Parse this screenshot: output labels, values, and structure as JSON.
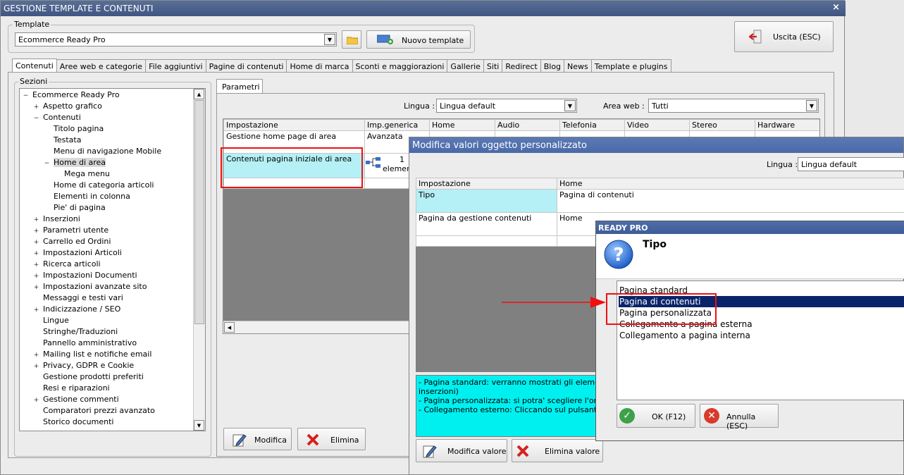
{
  "window": {
    "title": "GESTIONE TEMPLATE E CONTENUTI",
    "close": "×"
  },
  "template": {
    "group_label": "Template",
    "selected": "Ecommerce Ready Pro",
    "new_button": "Nuovo template"
  },
  "exit_button": "Uscita (ESC)",
  "tabs": [
    "Contenuti",
    "Aree web e categorie",
    "File aggiuntivi",
    "Pagine di contenuti",
    "Home di marca",
    "Sconti e maggiorazioni",
    "Gallerie",
    "Siti",
    "Redirect",
    "Blog",
    "News",
    "Template e plugins"
  ],
  "sections": {
    "label": "Sezioni",
    "tree": [
      {
        "label": "Ecommerce Ready Pro",
        "level": 0,
        "exp": "-"
      },
      {
        "label": "Aspetto grafico",
        "level": 1,
        "exp": "+"
      },
      {
        "label": "Contenuti",
        "level": 1,
        "exp": "-"
      },
      {
        "label": "Titolo pagina",
        "level": 2,
        "exp": ""
      },
      {
        "label": "Testata",
        "level": 2,
        "exp": ""
      },
      {
        "label": "Menu di navigazione Mobile",
        "level": 2,
        "exp": ""
      },
      {
        "label": "Home di area",
        "level": 2,
        "exp": "-",
        "selected": true
      },
      {
        "label": "Mega menu",
        "level": 3,
        "exp": ""
      },
      {
        "label": "Home di categoria articoli",
        "level": 2,
        "exp": ""
      },
      {
        "label": "Elementi in colonna",
        "level": 2,
        "exp": ""
      },
      {
        "label": "Pie' di pagina",
        "level": 2,
        "exp": ""
      },
      {
        "label": "Inserzioni",
        "level": 1,
        "exp": "+"
      },
      {
        "label": "Parametri utente",
        "level": 1,
        "exp": "+"
      },
      {
        "label": "Carrello ed Ordini",
        "level": 1,
        "exp": "+"
      },
      {
        "label": "Impostazioni Articoli",
        "level": 1,
        "exp": "+"
      },
      {
        "label": "Ricerca articoli",
        "level": 1,
        "exp": "+"
      },
      {
        "label": "Impostazioni Documenti",
        "level": 1,
        "exp": "+"
      },
      {
        "label": "Impostazioni avanzate sito",
        "level": 1,
        "exp": "+"
      },
      {
        "label": "Messaggi e testi vari",
        "level": 1,
        "exp": ""
      },
      {
        "label": "Indicizzazione / SEO",
        "level": 1,
        "exp": "+"
      },
      {
        "label": "Lingue",
        "level": 1,
        "exp": ""
      },
      {
        "label": "Stringhe/Traduzioni",
        "level": 1,
        "exp": ""
      },
      {
        "label": "Pannello amministrativo",
        "level": 1,
        "exp": ""
      },
      {
        "label": "Mailing list e notifiche email",
        "level": 1,
        "exp": "+"
      },
      {
        "label": "Privacy, GDPR e Cookie",
        "level": 1,
        "exp": "+"
      },
      {
        "label": "Gestione prodotti preferiti",
        "level": 1,
        "exp": ""
      },
      {
        "label": "Resi e riparazioni",
        "level": 1,
        "exp": ""
      },
      {
        "label": "Gestione commenti",
        "level": 1,
        "exp": "+"
      },
      {
        "label": "Comparatori prezzi avanzato",
        "level": 1,
        "exp": ""
      },
      {
        "label": "Storico documenti",
        "level": 1,
        "exp": ""
      }
    ]
  },
  "params": {
    "tab": "Parametri",
    "lingua_label": "Lingua :",
    "lingua_value": "Lingua default",
    "area_label": "Area web :",
    "area_value": "Tutti",
    "columns": [
      "Impostazione",
      "Imp.generica",
      "Home",
      "Audio",
      "Telefonia",
      "Video",
      "Stereo",
      "Hardware"
    ],
    "rows": [
      {
        "name": "Gestione home page di area",
        "generic": "Avanzata"
      },
      {
        "name": "Contenuti pagina iniziale di area",
        "generic_count": "1",
        "generic_unit": "element"
      }
    ],
    "modify_button": "Modifica",
    "delete_button": "Elimina"
  },
  "dialog": {
    "title": "Modifica valori oggetto personalizzato",
    "lingua_label": "Lingua :",
    "lingua_value": "Lingua default",
    "columns": [
      "Impostazione",
      "Home"
    ],
    "rows": [
      {
        "name": "Tipo",
        "value": "Pagina di contenuti"
      },
      {
        "name": "Pagina da gestione contenuti",
        "value": "Home"
      }
    ],
    "help_lines": [
      "- Pagina standard: verranno mostrati gli elementi in p",
      "inserzioni)",
      "- Pagina personalizzata: si potra' scegliere l'ordine de",
      "- Collegamento esterno: Cliccando sul pulsante relativ"
    ],
    "modify_value_button": "Modifica valore",
    "delete_value_button": "Elimina valore"
  },
  "msgbox": {
    "title": "READY PRO",
    "question": "Tipo",
    "options": [
      "Pagina standard",
      "Pagina di contenuti",
      "Pagina personalizzata",
      "Collegamento a pagina esterna",
      "Collegamento a pagina interna"
    ],
    "selected_index": 1,
    "ok_button": "OK (F12)",
    "cancel_button": "Annulla (ESC)"
  }
}
